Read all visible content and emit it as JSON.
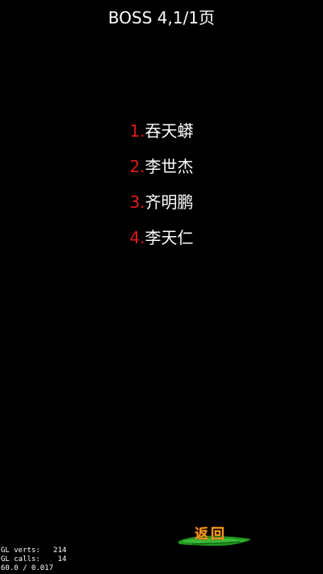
{
  "header": {
    "title": "BOSS 4,1/1页"
  },
  "boss_list": [
    {
      "num": "1.",
      "name": "吞天蟒"
    },
    {
      "num": "2.",
      "name": "李世杰"
    },
    {
      "num": "3.",
      "name": "齐明鹏"
    },
    {
      "num": "4.",
      "name": "李天仁"
    }
  ],
  "back_button": {
    "label": "返回",
    "icon": "green-brush-stroke"
  },
  "debug_stats": {
    "line1": "GL verts:   214",
    "line2": "GL calls:    14",
    "line3": "60.0 / 0.017"
  },
  "colors": {
    "background": "#000000",
    "number_red": "#e01a1a",
    "name_white": "#ffffff",
    "back_orange": "#f59a1e",
    "brush_green": "#1f9a1f"
  }
}
